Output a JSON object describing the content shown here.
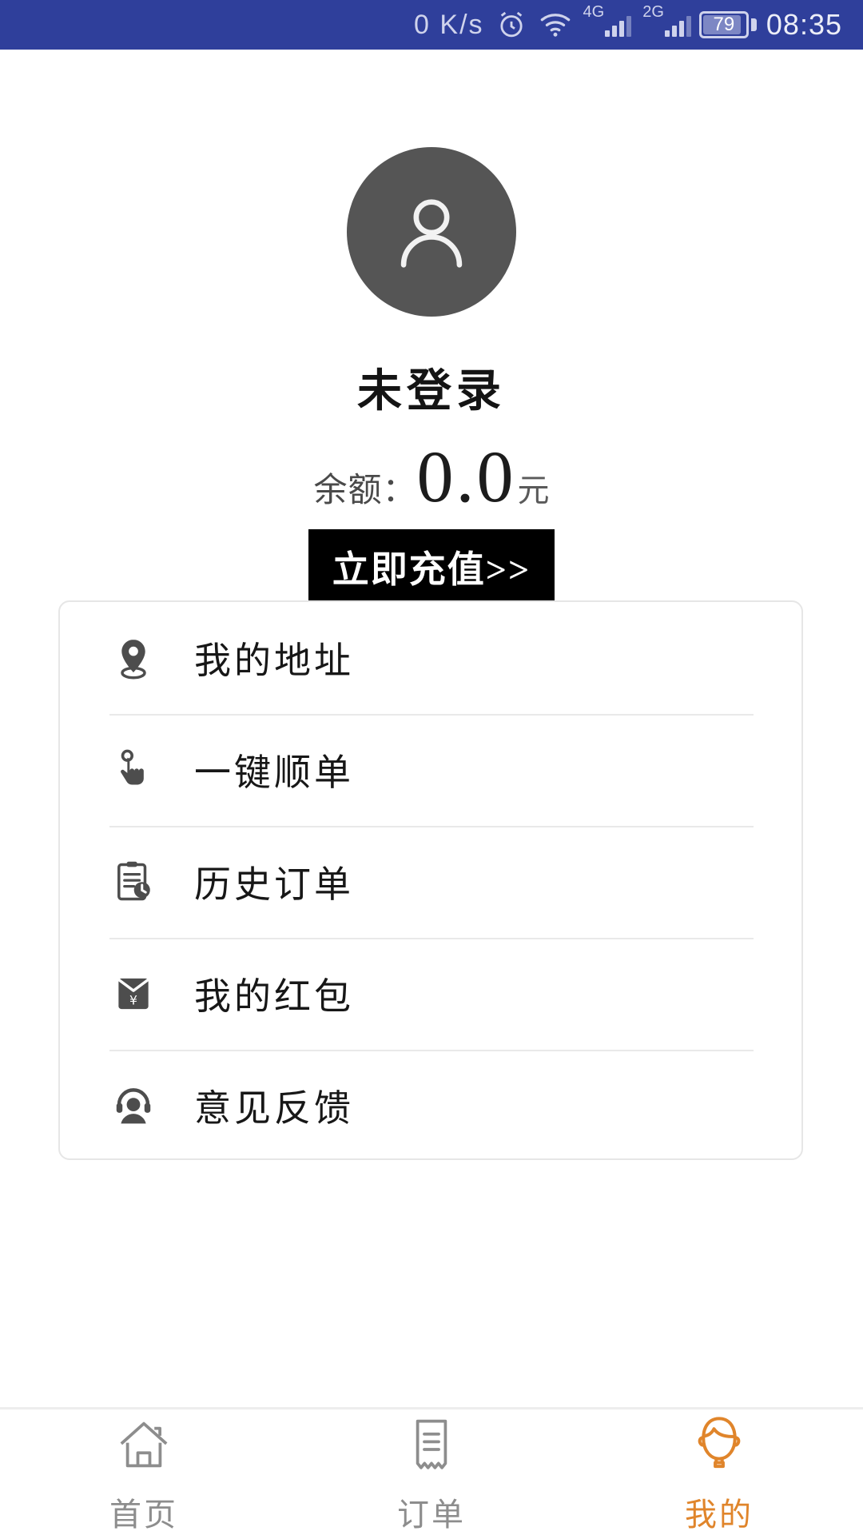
{
  "status_bar": {
    "network_speed": "0 K/s",
    "alarm_icon": "alarm-clock-icon",
    "wifi_icon": "wifi-icon",
    "sim1_label": "4G",
    "sim2_label": "2G",
    "battery_percent": "79",
    "time": "08:35",
    "background_color": "#2F3F9B"
  },
  "profile": {
    "avatar_icon": "user-avatar-icon",
    "username": "未登录",
    "balance_label": "余额：",
    "balance_value": "0.0",
    "balance_unit": "元",
    "recharge_label": "立即充值>>"
  },
  "menu": {
    "items": [
      {
        "icon": "location-pin-icon",
        "label": "我的地址"
      },
      {
        "icon": "tap-hand-icon",
        "label": "一键顺单"
      },
      {
        "icon": "clipboard-clock-icon",
        "label": "历史订单"
      },
      {
        "icon": "red-envelope-icon",
        "label": "我的红包"
      },
      {
        "icon": "headset-support-icon",
        "label": "意见反馈"
      }
    ]
  },
  "bottom_nav": {
    "active_color": "#E0852B",
    "inactive_color": "#8D8D8D",
    "tabs": [
      {
        "icon": "home-icon",
        "label": "首页",
        "active": false
      },
      {
        "icon": "receipt-icon",
        "label": "订单",
        "active": false
      },
      {
        "icon": "person-head-icon",
        "label": "我的",
        "active": true
      }
    ]
  }
}
